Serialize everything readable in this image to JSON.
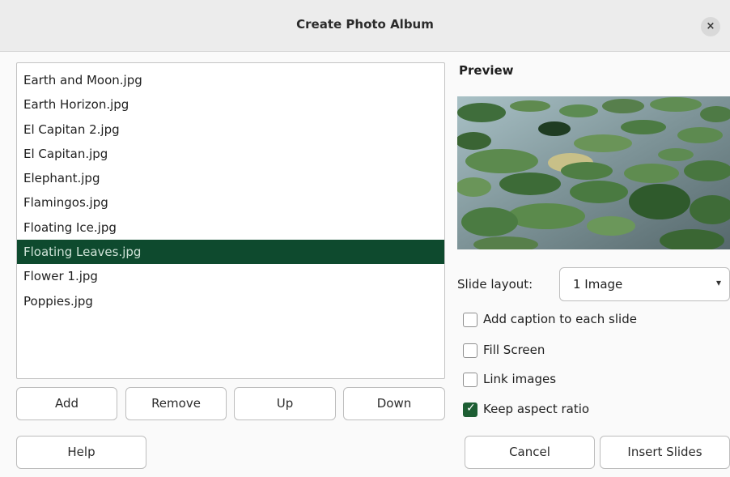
{
  "window": {
    "title": "Create Photo Album",
    "close_icon": "×"
  },
  "files": [
    "Earth and Moon.jpg",
    "Earth Horizon.jpg",
    "El Capitan 2.jpg",
    "El Capitan.jpg",
    "Elephant.jpg",
    "Flamingos.jpg",
    "Floating Ice.jpg",
    "Floating Leaves.jpg",
    "Flower 1.jpg",
    "Poppies.jpg"
  ],
  "selected_file": "Floating Leaves.jpg",
  "list_buttons": {
    "add": "Add",
    "remove": "Remove",
    "up": "Up",
    "down": "Down"
  },
  "preview": {
    "label": "Preview"
  },
  "slide_layout": {
    "label": "Slide layout:",
    "value": "1 Image"
  },
  "options": {
    "caption": {
      "label": "Add caption to each slide",
      "checked": false
    },
    "fill_screen": {
      "label": "Fill Screen",
      "checked": false
    },
    "link_images": {
      "label": "Link images",
      "checked": false
    },
    "keep_aspect": {
      "label": "Keep aspect ratio",
      "checked": true
    }
  },
  "footer": {
    "help": "Help",
    "cancel": "Cancel",
    "insert": "Insert Slides"
  },
  "colors": {
    "selection": "#0e4a2e",
    "checkbox_checked": "#1d5e33"
  }
}
